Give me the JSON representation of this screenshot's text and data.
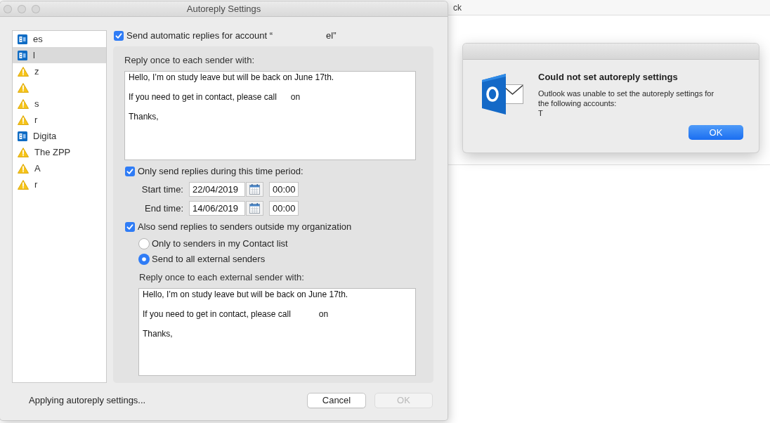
{
  "background_window": {
    "toolbar_text": "ck"
  },
  "window": {
    "title": "Autoreply Settings"
  },
  "accounts": [
    {
      "kind": "exchange",
      "name": "es",
      "selected": false
    },
    {
      "kind": "exchange",
      "name": "l",
      "selected": true
    },
    {
      "kind": "warning",
      "name": "z",
      "selected": false
    },
    {
      "kind": "warning",
      "selected": false
    },
    {
      "kind": "warning",
      "name": "s",
      "selected": false
    },
    {
      "kind": "warning",
      "name": "r",
      "selected": false
    },
    {
      "kind": "exchange",
      "name": "Digita",
      "selected": false
    },
    {
      "kind": "warning",
      "name": "The ZPP",
      "selected": false
    },
    {
      "kind": "warning",
      "name": "A",
      "selected": false
    },
    {
      "kind": "warning",
      "name": "r",
      "selected": false
    }
  ],
  "enable": {
    "label": "Send automatic replies for account “",
    "account_fragment": "el”",
    "checked": true
  },
  "reply": {
    "label": "Reply once to each sender with:",
    "lines": [
      "Hello, I’m on study leave but will be back on June 17th.",
      "If you need to get in contact, please call      on",
      "Thanks,"
    ]
  },
  "time_period": {
    "label": "Only send replies during this time period:",
    "checked": true,
    "start": {
      "label": "Start time:",
      "date": "22/04/2019",
      "time": "00:00"
    },
    "end": {
      "label": "End time:",
      "date": "14/06/2019",
      "time": "00:00"
    }
  },
  "external": {
    "label": "Also send replies to senders outside my organization",
    "checked": true,
    "options": [
      {
        "label": "Only to senders in my Contact list",
        "selected": false
      },
      {
        "label": "Send to all external senders",
        "selected": true
      }
    ],
    "reply_label": "Reply once to each external sender with:",
    "lines": [
      "Hello, I’m on study leave but will be back on June 17th.",
      "If you need to get in contact, please call            on",
      "Thanks,"
    ]
  },
  "status": "Applying autoreply settings...",
  "buttons": [
    {
      "label": "Cancel",
      "disabled": false
    },
    {
      "label": "OK",
      "disabled": true
    }
  ],
  "alert": {
    "title": "Could not set autoreply settings",
    "message": "Outlook was unable to set the autoreply settings for the following accounts:",
    "account": "T",
    "button": "OK"
  }
}
